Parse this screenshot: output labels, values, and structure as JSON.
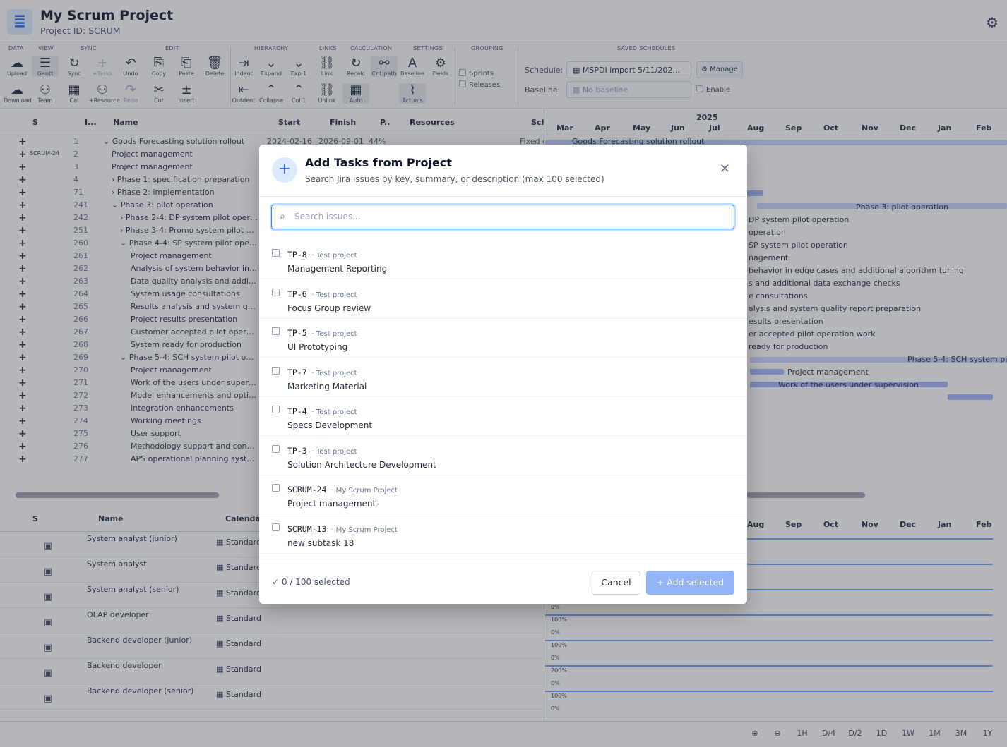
{
  "header": {
    "title": "My Scrum Project",
    "project_id": "Project ID: SCRUM",
    "logo_icon": "gantt-logo-icon",
    "settings_icon": "gear-icon"
  },
  "ribbon": {
    "groups": [
      "DATA",
      "VIEW",
      "SYNC",
      "EDIT",
      "HIERARCHY",
      "LINKS",
      "CALCULATION",
      "SETTINGS",
      "GROUPING",
      "SAVED SCHEDULES"
    ],
    "buttons": [
      "Upload",
      "Download",
      "Gantt",
      "Team",
      "Sync",
      "Cal",
      "+Tasks",
      "+Resource",
      "Undo",
      "Redo",
      "Copy",
      "Cut",
      "Paste",
      "Insert",
      "Delete",
      "Indent",
      "Outdent",
      "Expand",
      "Collapse",
      "Exp 1",
      "Col 1",
      "Link",
      "Unlink",
      "Recalc",
      "Auto",
      "Crit path",
      "Baseline",
      "Actuals",
      "Fields"
    ],
    "grouping": [
      "Sprints",
      "Releases"
    ],
    "schedule_label": "Schedule:",
    "schedule_value": "MSPDI import 5/11/202...",
    "manage": "Manage",
    "baseline_label": "Baseline:",
    "baseline_value": "No baseline",
    "enable": "Enable"
  },
  "grid": {
    "columns": [
      "S",
      "I...",
      "Name",
      "Start",
      "Finish",
      "P..",
      "Resources",
      "Sch"
    ],
    "rows": [
      {
        "key": "",
        "num": "1",
        "name": "Goods Forecasting solution rollout",
        "indent": 0,
        "caret": "⌄",
        "start": "2024-02-16",
        "finish": "2026-09-01",
        "pct": "44%",
        "sch": "Fixed c"
      },
      {
        "key": "SCRUM-24",
        "num": "2",
        "name": "Project management",
        "indent": 1,
        "caret": "",
        "start": "",
        "finish": "",
        "pct": "",
        "sch": ""
      },
      {
        "key": "",
        "num": "3",
        "name": "Project management",
        "indent": 1,
        "caret": "",
        "start": "",
        "finish": "",
        "pct": "",
        "sch": ""
      },
      {
        "key": "",
        "num": "4",
        "name": "Phase 1: specification preparation",
        "indent": 1,
        "caret": "›",
        "start": "",
        "finish": "",
        "pct": "",
        "sch": ""
      },
      {
        "key": "",
        "num": "71",
        "name": "Phase 2: implementation",
        "indent": 1,
        "caret": "›",
        "start": "",
        "finish": "",
        "pct": "",
        "sch": ""
      },
      {
        "key": "",
        "num": "241",
        "name": "Phase 3: pilot operation",
        "indent": 1,
        "caret": "⌄",
        "start": "",
        "finish": "",
        "pct": "",
        "sch": ""
      },
      {
        "key": "",
        "num": "242",
        "name": "Phase 2-4: DP system pilot operation",
        "indent": 2,
        "caret": "›",
        "start": "",
        "finish": "",
        "pct": "",
        "sch": ""
      },
      {
        "key": "",
        "num": "251",
        "name": "Phase 3-4: Promo system pilot ope...",
        "indent": 2,
        "caret": "›",
        "start": "",
        "finish": "",
        "pct": "",
        "sch": ""
      },
      {
        "key": "",
        "num": "260",
        "name": "Phase 4-4: SP system pilot operation",
        "indent": 2,
        "caret": "⌄",
        "start": "",
        "finish": "",
        "pct": "",
        "sch": ""
      },
      {
        "key": "",
        "num": "261",
        "name": "Project management",
        "indent": 3,
        "caret": "",
        "start": "",
        "finish": "",
        "pct": "",
        "sch": ""
      },
      {
        "key": "",
        "num": "262",
        "name": "Analysis of system behavior in edg...",
        "indent": 3,
        "caret": "",
        "start": "",
        "finish": "",
        "pct": "",
        "sch": ""
      },
      {
        "key": "",
        "num": "263",
        "name": "Data quality analysis and addition...",
        "indent": 3,
        "caret": "",
        "start": "",
        "finish": "",
        "pct": "",
        "sch": ""
      },
      {
        "key": "",
        "num": "264",
        "name": "System usage consultations",
        "indent": 3,
        "caret": "",
        "start": "",
        "finish": "",
        "pct": "",
        "sch": ""
      },
      {
        "key": "",
        "num": "265",
        "name": "Results analysis and system qualit...",
        "indent": 3,
        "caret": "",
        "start": "",
        "finish": "",
        "pct": "",
        "sch": ""
      },
      {
        "key": "",
        "num": "266",
        "name": "Project results presentation",
        "indent": 3,
        "caret": "",
        "start": "",
        "finish": "",
        "pct": "",
        "sch": ""
      },
      {
        "key": "",
        "num": "267",
        "name": "Customer accepted pilot operatio...",
        "indent": 3,
        "caret": "",
        "start": "",
        "finish": "",
        "pct": "",
        "sch": ""
      },
      {
        "key": "",
        "num": "268",
        "name": "System ready for production",
        "indent": 3,
        "caret": "",
        "start": "",
        "finish": "",
        "pct": "",
        "sch": ""
      },
      {
        "key": "",
        "num": "269",
        "name": "Phase 5-4: SCH system pilot operat...",
        "indent": 2,
        "caret": "⌄",
        "start": "",
        "finish": "",
        "pct": "",
        "sch": ""
      },
      {
        "key": "",
        "num": "270",
        "name": "Project management",
        "indent": 3,
        "caret": "",
        "start": "",
        "finish": "",
        "pct": "",
        "sch": ""
      },
      {
        "key": "",
        "num": "271",
        "name": "Work of the users under supervision",
        "indent": 3,
        "caret": "",
        "start": "",
        "finish": "",
        "pct": "",
        "sch": ""
      },
      {
        "key": "",
        "num": "272",
        "name": "Model enhancements and optimiz...",
        "indent": 3,
        "caret": "",
        "start": "",
        "finish": "",
        "pct": "",
        "sch": ""
      },
      {
        "key": "",
        "num": "273",
        "name": "Integration enhancements",
        "indent": 3,
        "caret": "",
        "start": "",
        "finish": "",
        "pct": "",
        "sch": ""
      },
      {
        "key": "",
        "num": "274",
        "name": "Working meetings",
        "indent": 3,
        "caret": "",
        "start": "",
        "finish": "",
        "pct": "",
        "sch": ""
      },
      {
        "key": "",
        "num": "275",
        "name": "User support",
        "indent": 3,
        "caret": "",
        "start": "",
        "finish": "",
        "pct": "",
        "sch": ""
      },
      {
        "key": "",
        "num": "276",
        "name": "Methodology support and consult...",
        "indent": 3,
        "caret": "",
        "start": "",
        "finish": "",
        "pct": "",
        "sch": ""
      },
      {
        "key": "",
        "num": "277",
        "name": "APS operational planning system ...",
        "indent": 3,
        "caret": "",
        "start": "",
        "finish": "",
        "pct": "",
        "sch": ""
      }
    ]
  },
  "gantt": {
    "year": "2025",
    "months": [
      "Mar",
      "Apr",
      "May",
      "Jun",
      "Jul",
      "Aug",
      "Sep",
      "Oct",
      "Nov",
      "Dec",
      "Jan",
      "Feb"
    ],
    "bar_labels": [
      "Goods Forecasting solution rollout",
      "Phase 3: pilot operation",
      "DP system pilot operation",
      "operation",
      "SP system pilot operation",
      "nagement",
      "behavior in edge cases and additional algorithm tuning",
      "s and additional data exchange checks",
      "e consultations",
      "alysis and system quality report preparation",
      "esults presentation",
      "er accepted pilot operation work",
      "ready for production",
      "Phase 5-4: SCH system pil",
      "Project management",
      "Work of the users under supervision"
    ]
  },
  "resources": {
    "columns": [
      "S",
      "Name",
      "Calendar"
    ],
    "rows": [
      {
        "name": "System analyst (junior)",
        "calendar": "Standard"
      },
      {
        "name": "System analyst",
        "calendar": "Standard"
      },
      {
        "name": "System analyst (senior)",
        "calendar": "Standard"
      },
      {
        "name": "OLAP developer",
        "calendar": "Standard"
      },
      {
        "name": "Backend developer (junior)",
        "calendar": "Standard"
      },
      {
        "name": "Backend developer",
        "calendar": "Standard"
      },
      {
        "name": "Backend developer (senior)",
        "calendar": "Standard"
      }
    ],
    "chart_months": [
      "Aug",
      "Sep",
      "Oct",
      "Nov",
      "Dec",
      "Jan",
      "Feb"
    ],
    "chart_labels": [
      "0%",
      "100%",
      "0%",
      "100%",
      "0%",
      "200%",
      "0%",
      "100%",
      "0%"
    ]
  },
  "zoom": [
    "1H",
    "D/4",
    "D/2",
    "1D",
    "1W",
    "1M",
    "3M",
    "1Y"
  ],
  "modal": {
    "title": "Add Tasks from Project",
    "subtitle": "Search Jira issues by key, summary, or description (max 100 selected)",
    "search_placeholder": "Search issues...",
    "items": [
      {
        "key": "TP-8",
        "project": "· Test project",
        "summary": "Management Reporting"
      },
      {
        "key": "TP-6",
        "project": "· Test project",
        "summary": "Focus Group review"
      },
      {
        "key": "TP-5",
        "project": "· Test project",
        "summary": "UI Prototyping"
      },
      {
        "key": "TP-7",
        "project": "· Test project",
        "summary": "Marketing Material"
      },
      {
        "key": "TP-4",
        "project": "· Test project",
        "summary": "Specs Development"
      },
      {
        "key": "TP-3",
        "project": "· Test project",
        "summary": "Solution Architecture Development"
      },
      {
        "key": "SCRUM-24",
        "project": "· My Scrum Project",
        "summary": "Project management"
      },
      {
        "key": "SCRUM-13",
        "project": "· My Scrum Project",
        "summary": "new subtask 18"
      }
    ],
    "selected_count": "0 / 100 selected",
    "cancel": "Cancel",
    "add": "Add selected",
    "accent": "#3b82f6"
  }
}
